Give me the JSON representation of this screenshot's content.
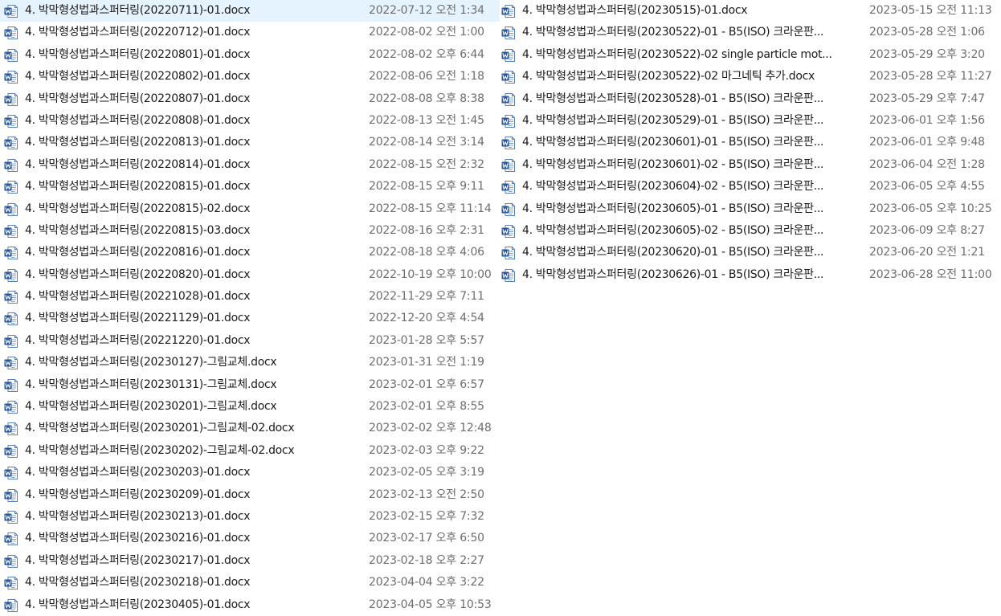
{
  "colors": {
    "name_text": "#1a1a1a",
    "date_text": "#6d6d6d",
    "word_icon_blue": "#2b579a",
    "hover_bg": "#e5f3ff"
  },
  "icon": "word-document-icon",
  "columns": [
    {
      "files": [
        {
          "name": "4. 박막형성법과스퍼터링(20220711)-01.docx",
          "date": "2022-07-12 오전 1:34"
        },
        {
          "name": "4. 박막형성법과스퍼터링(20220712)-01.docx",
          "date": "2022-08-02 오전 1:00"
        },
        {
          "name": "4. 박막형성법과스퍼터링(20220801)-01.docx",
          "date": "2022-08-02 오후 6:44"
        },
        {
          "name": "4. 박막형성법과스퍼터링(20220802)-01.docx",
          "date": "2022-08-06 오전 1:18"
        },
        {
          "name": "4. 박막형성법과스퍼터링(20220807)-01.docx",
          "date": "2022-08-08 오후 8:38"
        },
        {
          "name": "4. 박막형성법과스퍼터링(20220808)-01.docx",
          "date": "2022-08-13 오전 1:45"
        },
        {
          "name": "4. 박막형성법과스퍼터링(20220813)-01.docx",
          "date": "2022-08-14 오전 3:14"
        },
        {
          "name": "4. 박막형성법과스퍼터링(20220814)-01.docx",
          "date": "2022-08-15 오전 2:32"
        },
        {
          "name": "4. 박막형성법과스퍼터링(20220815)-01.docx",
          "date": "2022-08-15 오후 9:11"
        },
        {
          "name": "4. 박막형성법과스퍼터링(20220815)-02.docx",
          "date": "2022-08-15 오후 11:14"
        },
        {
          "name": "4. 박막형성법과스퍼터링(20220815)-03.docx",
          "date": "2022-08-16 오후 2:31"
        },
        {
          "name": "4. 박막형성법과스퍼터링(20220816)-01.docx",
          "date": "2022-08-18 오후 4:06"
        },
        {
          "name": "4. 박막형성법과스퍼터링(20220820)-01.docx",
          "date": "2022-10-19 오후 10:00"
        },
        {
          "name": "4. 박막형성법과스퍼터링(20221028)-01.docx",
          "date": "2022-11-29 오후 7:11"
        },
        {
          "name": "4. 박막형성법과스퍼터링(20221129)-01.docx",
          "date": "2022-12-20 오후 4:54"
        },
        {
          "name": "4. 박막형성법과스퍼터링(20221220)-01.docx",
          "date": "2023-01-28 오후 5:57"
        },
        {
          "name": "4. 박막형성법과스퍼터링(20230127)-그림교체.docx",
          "date": "2023-01-31 오전 1:19"
        },
        {
          "name": "4. 박막형성법과스퍼터링(20230131)-그림교체.docx",
          "date": "2023-02-01 오후 6:57"
        },
        {
          "name": "4. 박막형성법과스퍼터링(20230201)-그림교체.docx",
          "date": "2023-02-01 오후 8:55"
        },
        {
          "name": "4. 박막형성법과스퍼터링(20230201)-그림교체-02.docx",
          "date": "2023-02-02 오후 12:48"
        },
        {
          "name": "4. 박막형성법과스퍼터링(20230202)-그림교체-02.docx",
          "date": "2023-02-03 오후 9:22"
        },
        {
          "name": "4. 박막형성법과스퍼터링(20230203)-01.docx",
          "date": "2023-02-05 오후 3:19"
        },
        {
          "name": "4. 박막형성법과스퍼터링(20230209)-01.docx",
          "date": "2023-02-13 오전 2:50"
        },
        {
          "name": "4. 박막형성법과스퍼터링(20230213)-01.docx",
          "date": "2023-02-15 오후 7:32"
        },
        {
          "name": "4. 박막형성법과스퍼터링(20230216)-01.docx",
          "date": "2023-02-17 오후 6:50"
        },
        {
          "name": "4. 박막형성법과스퍼터링(20230217)-01.docx",
          "date": "2023-02-18 오후 2:27"
        },
        {
          "name": "4. 박막형성법과스퍼터링(20230218)-01.docx",
          "date": "2023-04-04 오후 3:22"
        },
        {
          "name": "4. 박막형성법과스퍼터링(20230405)-01.docx",
          "date": "2023-04-05 오후 10:53"
        }
      ]
    },
    {
      "files": [
        {
          "name": "4. 박막형성법과스퍼터링(20230515)-01.docx",
          "date": "2023-05-15 오전 11:13"
        },
        {
          "name": "4. 박막형성법과스퍼터링(20230522)-01 - B5(ISO) 크라운판...",
          "date": "2023-05-28 오전 1:06"
        },
        {
          "name": "4. 박막형성법과스퍼터링(20230522)-02 single particle mot...",
          "date": "2023-05-29 오후 3:20"
        },
        {
          "name": "4. 박막형성법과스퍼터링(20230522)-02 마그네틱 추가.docx",
          "date": "2023-05-28 오후 11:27"
        },
        {
          "name": "4. 박막형성법과스퍼터링(20230528)-01 - B5(ISO) 크라운판...",
          "date": "2023-05-29 오후 7:47"
        },
        {
          "name": "4. 박막형성법과스퍼터링(20230529)-01 - B5(ISO) 크라운판...",
          "date": "2023-06-01 오후 1:56"
        },
        {
          "name": "4. 박막형성법과스퍼터링(20230601)-01 - B5(ISO) 크라운판...",
          "date": "2023-06-01 오후 9:48"
        },
        {
          "name": "4. 박막형성법과스퍼터링(20230601)-02 - B5(ISO) 크라운판...",
          "date": "2023-06-04 오전 1:28"
        },
        {
          "name": "4. 박막형성법과스퍼터링(20230604)-02 - B5(ISO) 크라운판...",
          "date": "2023-06-05 오후 4:55"
        },
        {
          "name": "4. 박막형성법과스퍼터링(20230605)-01 - B5(ISO) 크라운판...",
          "date": "2023-06-05 오후 10:25"
        },
        {
          "name": "4. 박막형성법과스퍼터링(20230605)-02 - B5(ISO) 크라운판...",
          "date": "2023-06-09 오후 8:27"
        },
        {
          "name": "4. 박막형성법과스퍼터링(20230620)-01 - B5(ISO) 크라운판...",
          "date": "2023-06-20 오전 1:21"
        },
        {
          "name": "4. 박막형성법과스퍼터링(20230626)-01 - B5(ISO) 크라운판...",
          "date": "2023-06-28 오전 11:00"
        }
      ]
    }
  ]
}
